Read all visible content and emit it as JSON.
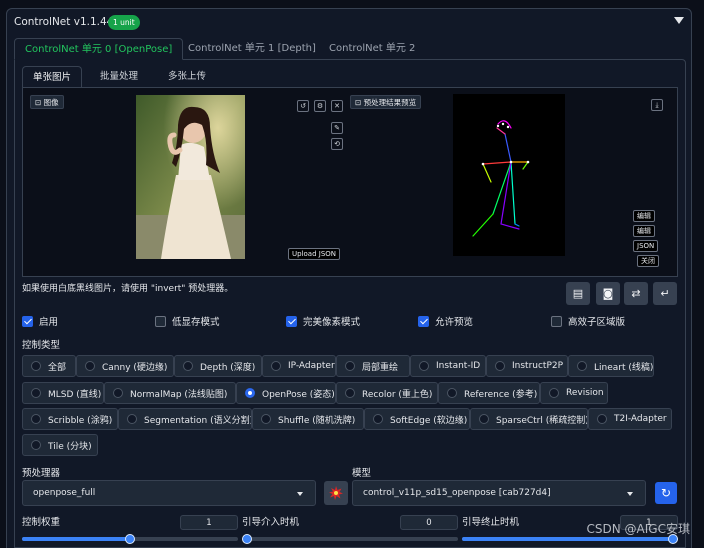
{
  "header": {
    "title": "ControlNet v1.1.449",
    "badge": "1 unit"
  },
  "unit_tabs": [
    {
      "label": "ControlNet 单元 0 [OpenPose]",
      "active": true
    },
    {
      "label": "ControlNet 单元 1 [Depth]",
      "active": false
    },
    {
      "label": "ControlNet 单元 2",
      "active": false
    }
  ],
  "mode_tabs": [
    {
      "label": "单张图片",
      "active": true
    },
    {
      "label": "批量处理",
      "active": false
    },
    {
      "label": "多张上传",
      "active": false
    }
  ],
  "image_panel": {
    "image_label": "图像",
    "upload_json": "Upload JSON",
    "tool_icons": [
      "undo-icon",
      "settings-icon",
      "close-icon",
      "edit-icon",
      "rotate-icon"
    ]
  },
  "preview_panel": {
    "label": "预处理结果预览",
    "buttons": [
      "编辑",
      "编辑",
      "JSON",
      "关闭"
    ]
  },
  "hint": "如果使用白底黑线图片，请使用 \"invert\" 预处理器。",
  "checkboxes": [
    {
      "label": "启用",
      "checked": true
    },
    {
      "label": "低显存模式",
      "checked": false
    },
    {
      "label": "完美像素模式",
      "checked": true
    },
    {
      "label": "允许预览",
      "checked": true
    },
    {
      "label": "高效子区域版",
      "checked": false
    }
  ],
  "control_type": {
    "label": "控制类型",
    "rows": [
      [
        {
          "label": "全部",
          "selected": false
        },
        {
          "label": "Canny (硬边缘)",
          "selected": false
        },
        {
          "label": "Depth (深度)",
          "selected": false
        },
        {
          "label": "IP-Adapter",
          "selected": false
        },
        {
          "label": "局部重绘",
          "selected": false
        },
        {
          "label": "Instant-ID",
          "selected": false
        },
        {
          "label": "InstructP2P",
          "selected": false
        },
        {
          "label": "Lineart (线稿)",
          "selected": false
        }
      ],
      [
        {
          "label": "MLSD (直线)",
          "selected": false
        },
        {
          "label": "NormalMap (法线贴图)",
          "selected": false
        },
        {
          "label": "OpenPose (姿态)",
          "selected": true
        },
        {
          "label": "Recolor (重上色)",
          "selected": false
        },
        {
          "label": "Reference (参考)",
          "selected": false
        },
        {
          "label": "Revision",
          "selected": false
        }
      ],
      [
        {
          "label": "Scribble (涂鸦)",
          "selected": false
        },
        {
          "label": "Segmentation (语义分割)",
          "selected": false
        },
        {
          "label": "Shuffle (随机洗牌)",
          "selected": false
        },
        {
          "label": "SoftEdge (软边缘)",
          "selected": false
        },
        {
          "label": "SparseCtrl (稀疏控制)",
          "selected": false
        },
        {
          "label": "T2I-Adapter",
          "selected": false
        }
      ],
      [
        {
          "label": "Tile (分块)",
          "selected": false
        }
      ]
    ]
  },
  "preprocessor": {
    "label": "预处理器",
    "value": "openpose_full"
  },
  "model": {
    "label": "模型",
    "value": "control_v11p_sd15_openpose [cab727d4]"
  },
  "sliders": {
    "weight": {
      "label": "控制权重",
      "value": "1",
      "fraction": 0.5
    },
    "start": {
      "label": "引导介入时机",
      "value": "0",
      "fraction": 0.0
    },
    "end": {
      "label": "引导终止时机",
      "value": "1",
      "fraction": 1.0
    }
  },
  "watermark": "CSDN @AIGC安琪",
  "colors": {
    "accent": "#22c55e",
    "primary": "#2563eb",
    "badge": "#16a34a",
    "fire_button": "#dc2626"
  }
}
